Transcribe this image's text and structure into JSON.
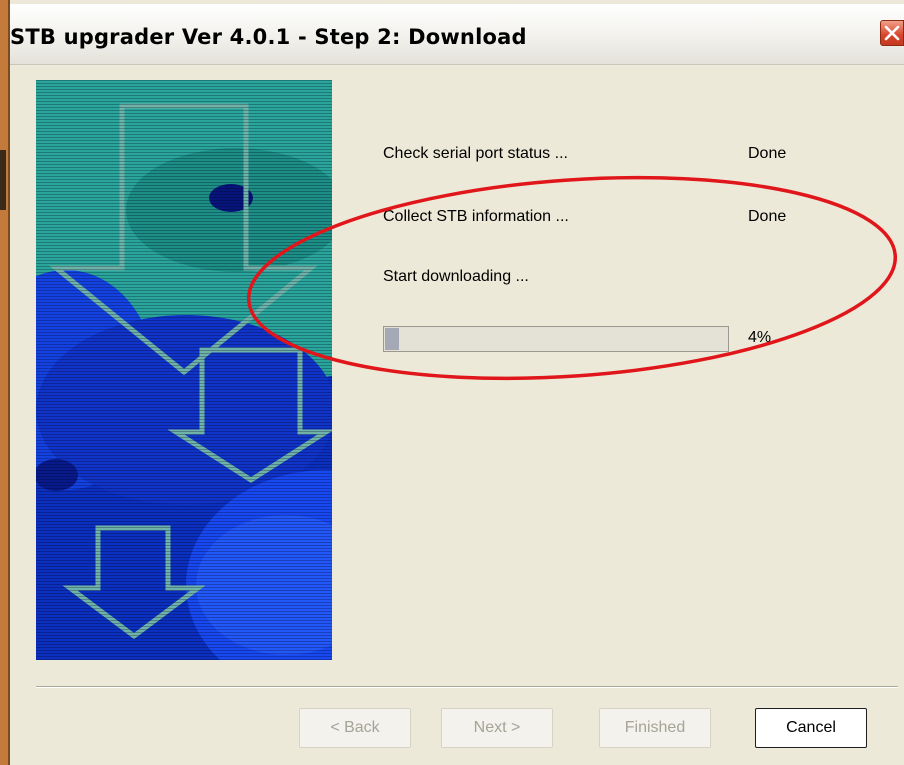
{
  "window": {
    "title": "STB upgrader Ver 4.0.1 - Step 2: Download",
    "close_icon": "close-x-icon",
    "close_color": "#d8442a"
  },
  "banner": {
    "description_icon": "download-arrows-graphic",
    "colors": {
      "background": "#0b2fbf",
      "teal": "#2aa59a",
      "arrow": "#6fb3a8"
    }
  },
  "steps": [
    {
      "label": "Check serial port status ...",
      "status": "Done"
    },
    {
      "label": "Collect STB information ...",
      "status": "Done"
    },
    {
      "label": "Start downloading ...",
      "status": ""
    }
  ],
  "progress": {
    "percent_text": "4%",
    "fraction": 0.04,
    "fill_color": "#a5a8b5"
  },
  "buttons": {
    "back": "< Back",
    "next": "Next >",
    "finished": "Finished",
    "cancel": "Cancel"
  },
  "annotation": {
    "shape": "ellipse",
    "color": "#e0161b"
  }
}
